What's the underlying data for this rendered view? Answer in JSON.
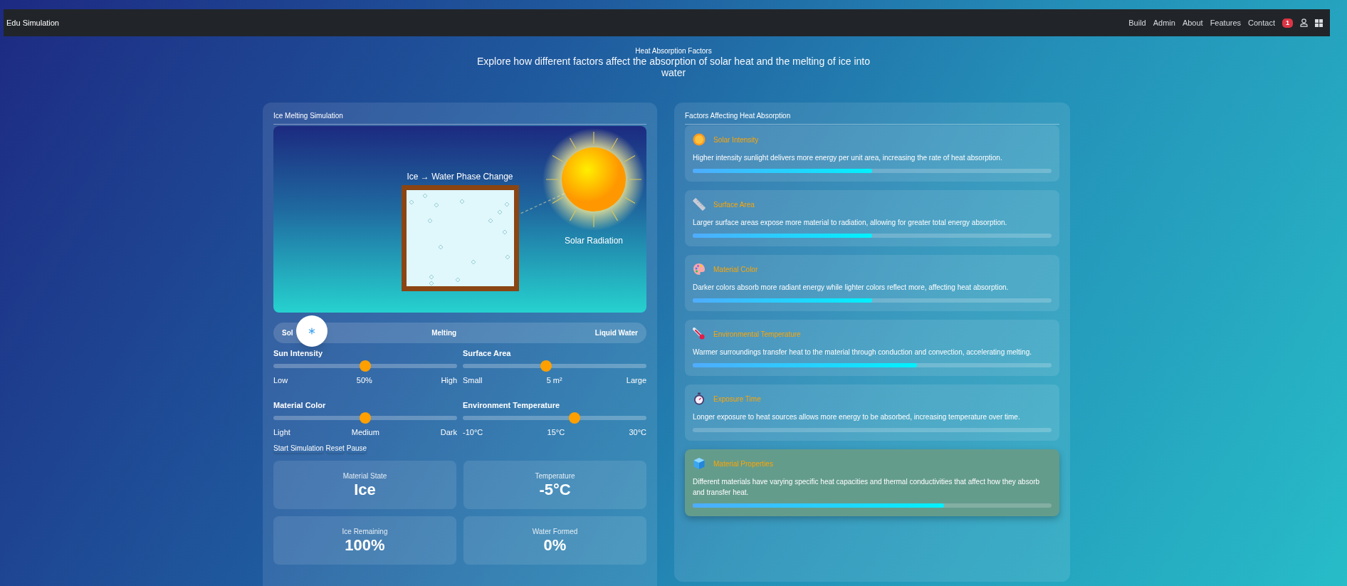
{
  "navbar": {
    "brand": "Edu Simulation",
    "links": [
      "Build",
      "Admin",
      "About",
      "Features",
      "Contact"
    ],
    "notification_count": "1"
  },
  "header": {
    "title": "Heat Absorption Factors",
    "subtitle": "Explore how different factors affect the absorption of solar heat and the melting of ice into water"
  },
  "simulation": {
    "title": "Ice Melting Simulation",
    "phase_title": "Ice → Water Phase Change",
    "sun_label": "Solar Radiation",
    "phases": [
      "Sol",
      "Melting",
      "Liquid Water"
    ],
    "sliders": [
      {
        "label": "Sun Intensity",
        "level": 0.5,
        "min_label": "Low",
        "value_label": "50%",
        "max_label": "High"
      },
      {
        "label": "Surface Area",
        "level": 0.45,
        "min_label": "Small",
        "value_label": "5 m²",
        "max_label": "Large"
      },
      {
        "label": "Material Color",
        "level": 0.5,
        "min_label": "Light",
        "value_label": "Medium",
        "max_label": "Dark"
      },
      {
        "label": "Environment Temperature",
        "level": 0.615,
        "min_label": "-10°C",
        "value_label": "15°C",
        "max_label": "30°C"
      }
    ],
    "buttons": [
      "Start Simulation",
      "Reset",
      "Pause"
    ],
    "stats": [
      {
        "label": "Material State",
        "value": "Ice"
      },
      {
        "label": "Temperature",
        "value": "-5°C"
      },
      {
        "label": "Ice Remaining",
        "value": "100%"
      },
      {
        "label": "Water Formed",
        "value": "0%"
      }
    ]
  },
  "factors": {
    "title": "Factors Affecting Heat Absorption",
    "items": [
      {
        "kind": "sun",
        "title": "Solar Intensity",
        "description": "Higher intensity sunlight delivers more energy per unit area, increasing the rate of heat absorption.",
        "level": 0.5,
        "highlighted": false
      },
      {
        "kind": "ruler",
        "title": "Surface Area",
        "description": "Larger surface areas expose more material to radiation, allowing for greater total energy absorption.",
        "level": 0.5,
        "highlighted": false
      },
      {
        "kind": "palette",
        "title": "Material Color",
        "description": "Darker colors absorb more radiant energy while lighter colors reflect more, affecting heat absorption.",
        "level": 0.5,
        "highlighted": false
      },
      {
        "kind": "thermometer",
        "title": "Environmental Temperature",
        "description": "Warmer surroundings transfer heat to the material through conduction and convection, accelerating melting.",
        "level": 0.625,
        "highlighted": false
      },
      {
        "kind": "stopwatch",
        "title": "Exposure Time",
        "description": "Longer exposure to heat sources allows more energy to be absorbed, increasing temperature over time.",
        "level": 0,
        "highlighted": false
      },
      {
        "kind": "cube",
        "title": "Material Properties",
        "description": "Different materials have varying specific heat capacities and thermal conductivities that affect how they absorb and transfer heat.",
        "level": 0.7,
        "highlighted": true
      }
    ]
  }
}
